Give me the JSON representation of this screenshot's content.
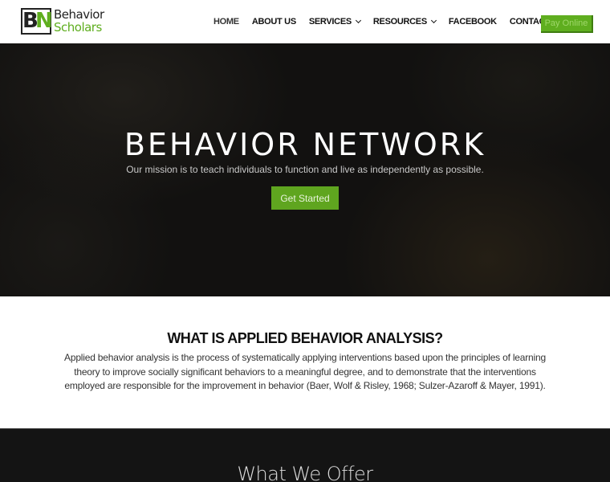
{
  "header": {
    "logo": {
      "mark_b": "B",
      "mark_n": "N",
      "line1": "Behavior",
      "line2": "Scholars"
    },
    "nav": [
      {
        "label": "HOME",
        "dropdown": false
      },
      {
        "label": "ABOUT US",
        "dropdown": false
      },
      {
        "label": "SERVICES",
        "dropdown": true
      },
      {
        "label": "RESOURCES",
        "dropdown": true
      },
      {
        "label": "FACEBOOK",
        "dropdown": false
      },
      {
        "label": "CONTACT US",
        "dropdown": false
      }
    ],
    "pay_button": "Pay Online"
  },
  "hero": {
    "title": "BEHAVIOR NETWORK",
    "subtitle": "Our mission is to teach individuals to function and live as independently as possible.",
    "cta": "Get Started"
  },
  "aba": {
    "title": "WHAT IS APPLIED BEHAVIOR ANALYSIS?",
    "text": "Applied behavior analysis is the process of systematically applying interventions based upon the principles of learning theory to improve socially significant behaviors to a meaningful degree, and to demonstrate that the interventions employed are responsible for the improvement in behavior (Baer, Wolf & Risley, 1968; Sulzer-Azaroff & Mayer, 1991)."
  },
  "offer": {
    "title": "What We Offer"
  },
  "colors": {
    "accent": "#5fae1f",
    "dark": "#141414"
  }
}
